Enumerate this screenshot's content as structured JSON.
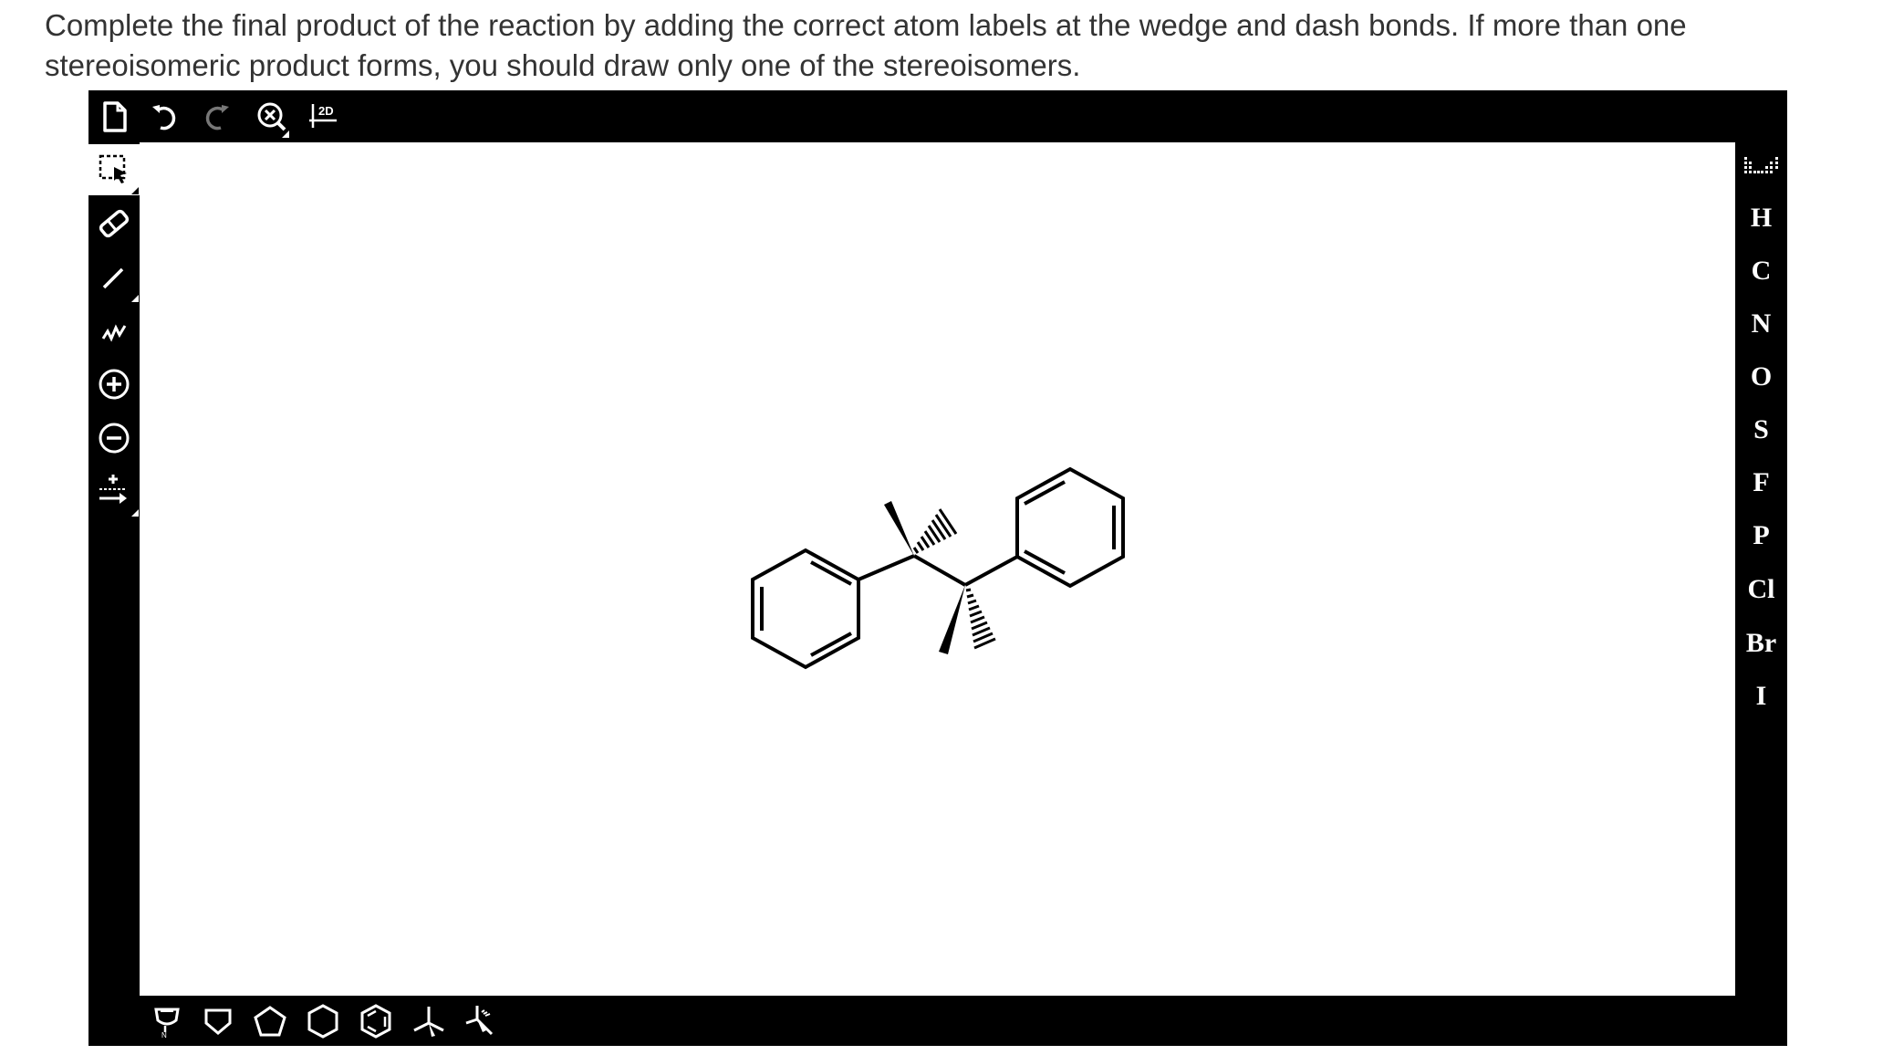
{
  "question": {
    "text": "Complete the final product of the reaction by adding the correct atom labels at the wedge and dash bonds. If more than one stereoisomeric product forms, you should draw only one of the stereoisomers."
  },
  "top_toolbar": {
    "items": [
      {
        "name": "new-document",
        "icon": "document-icon"
      },
      {
        "name": "undo",
        "icon": "undo-icon"
      },
      {
        "name": "redo",
        "icon": "redo-icon"
      },
      {
        "name": "zoom",
        "icon": "zoom-icon"
      },
      {
        "name": "clean-2d",
        "icon": "clean-2d-icon",
        "label": "2D"
      }
    ]
  },
  "left_toolbar": {
    "items": [
      {
        "name": "select",
        "icon": "select-icon",
        "selected": true
      },
      {
        "name": "erase",
        "icon": "eraser-icon"
      },
      {
        "name": "bond",
        "icon": "single-bond-icon"
      },
      {
        "name": "chain",
        "icon": "chain-icon"
      },
      {
        "name": "charge-plus",
        "icon": "plus-charge-icon"
      },
      {
        "name": "charge-minus",
        "icon": "minus-charge-icon"
      },
      {
        "name": "reaction-arrow",
        "icon": "reaction-arrow-icon"
      }
    ]
  },
  "right_toolbar": {
    "periodic_icon": "periodic-table-icon",
    "atoms": [
      "H",
      "C",
      "N",
      "O",
      "S",
      "F",
      "P",
      "Cl",
      "Br",
      "I"
    ]
  },
  "bottom_toolbar": {
    "items": [
      {
        "name": "template-ring",
        "icon": "template-ring-icon"
      },
      {
        "name": "cyclobutane",
        "icon": "cyclobutane-icon"
      },
      {
        "name": "cyclopentane",
        "icon": "cyclopentane-icon"
      },
      {
        "name": "cyclohexane",
        "icon": "cyclohexane-icon"
      },
      {
        "name": "benzene",
        "icon": "benzene-icon"
      },
      {
        "name": "stereo-template-1",
        "icon": "stereo-center-icon"
      },
      {
        "name": "stereo-template-2",
        "icon": "stereo-center-dash-icon"
      }
    ]
  },
  "molecule": {
    "description_icon": "molecule-structure"
  }
}
